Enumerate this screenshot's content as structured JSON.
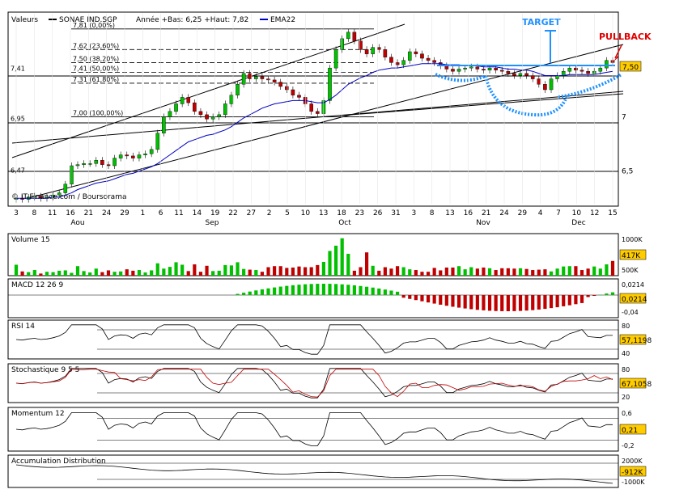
{
  "header": {
    "label": "Valeurs",
    "symbol": "SONAE IND.SGP",
    "range_text": "Année +Bas: 6,25 +Haut: 7,82",
    "ema_label": "EMA22"
  },
  "watermark": "© IT-Finance.com / Boursorama",
  "annotations": {
    "target": "TARGET",
    "pullback": "PULLBACK"
  },
  "colors": {
    "up": "#00c000",
    "down": "#c00000",
    "ema": "#0000c0",
    "annotation": "#1e90ff",
    "pullback": "#e00000",
    "badge": "#ffcc00"
  },
  "chart_data": {
    "type": "candlestick",
    "x_ticks": [
      "3",
      "8",
      "11",
      "16",
      "21",
      "24",
      "29",
      "1",
      "6",
      "11",
      "14",
      "19",
      "22",
      "27",
      "2",
      "5",
      "10",
      "13",
      "18",
      "23",
      "26",
      "31",
      "3",
      "8",
      "13",
      "16",
      "21",
      "24",
      "29",
      "4",
      "7",
      "10",
      "12",
      "15"
    ],
    "months": [
      "Aou",
      "Sep",
      "Oct",
      "Nov",
      "Dec"
    ],
    "price_axis": {
      "ylim": [
        6.2,
        7.95
      ],
      "ticks": [
        {
          "v": 6.5,
          "label": "6,5"
        },
        {
          "v": 7,
          "label": "7"
        }
      ],
      "left_labels": [
        {
          "v": 7.41,
          "label": "7,41"
        },
        {
          "v": 6.95,
          "label": "6,95"
        },
        {
          "v": 6.47,
          "label": "6,47"
        }
      ]
    },
    "fibonacci": [
      {
        "v": 7.81,
        "label": "7,81 (0,00%)"
      },
      {
        "v": 7.62,
        "label": "7,62 (23,60%)"
      },
      {
        "v": 7.5,
        "label": "7,50 (38,20%)"
      },
      {
        "v": 7.41,
        "label": "7,41 (50,00%)"
      },
      {
        "v": 7.31,
        "label": "7,31 (61,80%)"
      },
      {
        "v": 7.0,
        "label": "7,00 (100,00%)"
      }
    ],
    "last_price": "7,50",
    "closes": [
      6.25,
      6.24,
      6.26,
      6.27,
      6.25,
      6.26,
      6.28,
      6.3,
      6.38,
      6.55,
      6.56,
      6.57,
      6.57,
      6.6,
      6.56,
      6.55,
      6.62,
      6.65,
      6.64,
      6.62,
      6.65,
      6.66,
      6.7,
      6.85,
      7.0,
      7.05,
      7.12,
      7.18,
      7.13,
      7.05,
      7.02,
      6.98,
      7.0,
      7.02,
      7.12,
      7.2,
      7.3,
      7.4,
      7.35,
      7.37,
      7.35,
      7.34,
      7.32,
      7.28,
      7.25,
      7.2,
      7.18,
      7.12,
      7.05,
      7.03,
      7.15,
      7.45,
      7.62,
      7.72,
      7.78,
      7.7,
      7.62,
      7.58,
      7.64,
      7.62,
      7.55,
      7.5,
      7.48,
      7.52,
      7.6,
      7.58,
      7.54,
      7.52,
      7.5,
      7.47,
      7.44,
      7.42,
      7.44,
      7.45,
      7.46,
      7.44,
      7.43,
      7.45,
      7.43,
      7.42,
      7.4,
      7.38,
      7.4,
      7.38,
      7.35,
      7.3,
      7.25,
      7.35,
      7.38,
      7.42,
      7.45,
      7.43,
      7.42,
      7.4,
      7.42,
      7.45,
      7.52,
      7.5
    ],
    "ema22": [
      6.25,
      6.25,
      6.25,
      6.25,
      6.25,
      6.25,
      6.26,
      6.26,
      6.28,
      6.3,
      6.33,
      6.35,
      6.37,
      6.39,
      6.4,
      6.41,
      6.43,
      6.45,
      6.47,
      6.48,
      6.5,
      6.52,
      6.54,
      6.57,
      6.61,
      6.65,
      6.69,
      6.73,
      6.77,
      6.79,
      6.81,
      6.83,
      6.84,
      6.86,
      6.88,
      6.91,
      6.95,
      6.99,
      7.02,
      7.05,
      7.08,
      7.1,
      7.12,
      7.13,
      7.14,
      7.15,
      7.15,
      7.15,
      7.14,
      7.13,
      7.13,
      7.16,
      7.2,
      7.25,
      7.3,
      7.33,
      7.36,
      7.38,
      7.41,
      7.43,
      7.44,
      7.45,
      7.45,
      7.46,
      7.47,
      7.48,
      7.49,
      7.49,
      7.49,
      7.49,
      7.48,
      7.48,
      7.48,
      7.47,
      7.47,
      7.47,
      7.46,
      7.46,
      7.46,
      7.45,
      7.44,
      7.44,
      7.43,
      7.43,
      7.42,
      7.4,
      7.38,
      7.38,
      7.38,
      7.38,
      7.39,
      7.39,
      7.39,
      7.39,
      7.39,
      7.4,
      7.41,
      7.42
    ],
    "volume": {
      "label": "Volume 15",
      "ticks": [
        {
          "v": 1000,
          "label": "1000K"
        },
        {
          "v": 500,
          "label": "500K"
        }
      ],
      "last": "417K",
      "values": [
        310,
        120,
        100,
        160,
        60,
        110,
        100,
        140,
        150,
        80,
        270,
        130,
        90,
        200,
        100,
        150,
        110,
        120,
        180,
        140,
        160,
        90,
        150,
        350,
        200,
        250,
        380,
        310,
        130,
        320,
        110,
        280,
        130,
        140,
        300,
        290,
        380,
        190,
        170,
        160,
        110,
        240,
        270,
        270,
        220,
        230,
        260,
        240,
        240,
        300,
        390,
        700,
        850,
        1060,
        620,
        140,
        240,
        660,
        280,
        140,
        240,
        200,
        270,
        240,
        180,
        160,
        110,
        110,
        220,
        150,
        230,
        230,
        270,
        180,
        240,
        200,
        230,
        210,
        160,
        210,
        210,
        200,
        210,
        190,
        160,
        170,
        180,
        120,
        200,
        260,
        270,
        270,
        160,
        200,
        260,
        200,
        320,
        417
      ]
    },
    "macd": {
      "label": "MACD 12 26 9",
      "ticks": [
        {
          "v": 0.0214,
          "label": "0,0214"
        },
        {
          "v": -0.04,
          "label": "-0,04"
        }
      ],
      "last": "0,0214"
    },
    "rsi": {
      "label": "RSI 14",
      "ticks": [
        {
          "v": 80,
          "label": "80"
        },
        {
          "v": 40,
          "label": "40"
        }
      ],
      "last": "57,1198"
    },
    "stochastic": {
      "label": "Stochastique 9 5 5",
      "ticks": [
        {
          "v": 80,
          "label": "80"
        },
        {
          "v": 20,
          "label": "20"
        }
      ],
      "last": "67,1058"
    },
    "momentum": {
      "label": "Momentum 12",
      "ticks": [
        {
          "v": 0.6,
          "label": "0,6"
        },
        {
          "v": -0.2,
          "label": "-0,2"
        }
      ],
      "last": "0,21"
    },
    "accumulation": {
      "label": "Accumulation Distribution",
      "ticks": [
        {
          "v": 2000,
          "label": "2000K"
        },
        {
          "v": -1000,
          "label": "-1000K"
        }
      ],
      "last": "-912K"
    }
  }
}
